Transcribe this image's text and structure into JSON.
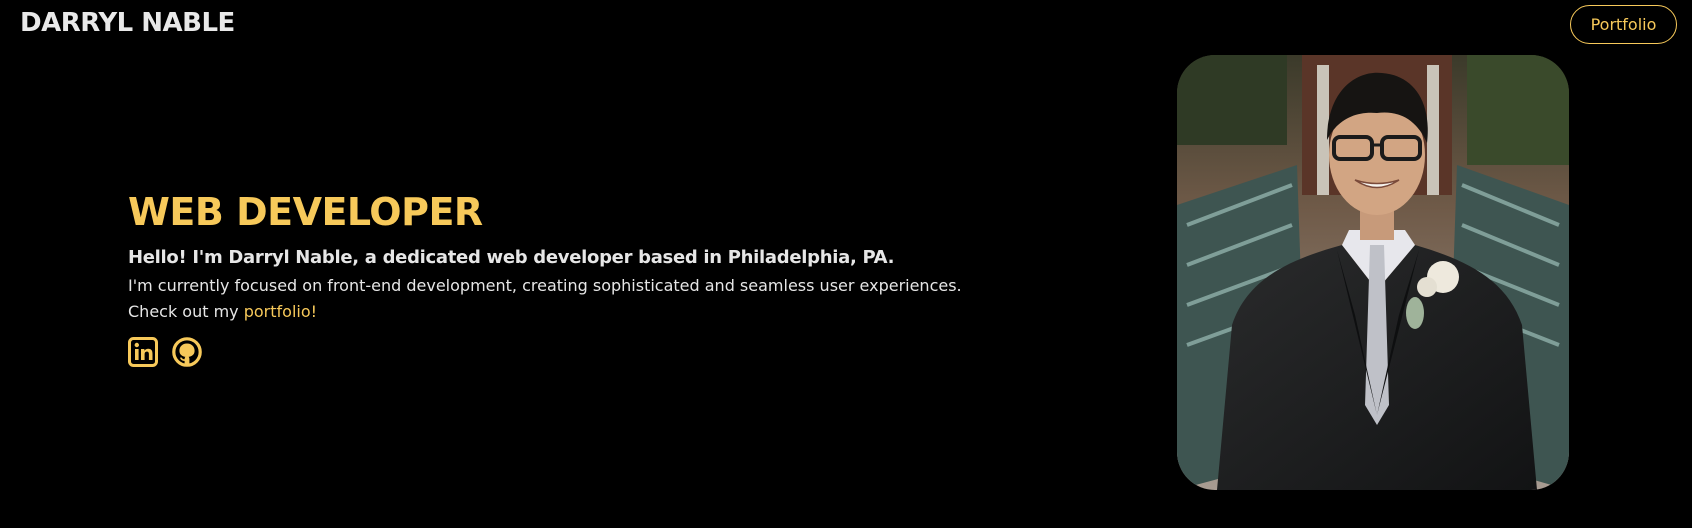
{
  "header": {
    "brand": "DARRYL NABLE",
    "nav_button": "Portfolio"
  },
  "hero": {
    "title": "WEB DEVELOPER",
    "subtitle": "Hello! I'm Darryl Nable, a dedicated web developer based in Philadelphia, PA.",
    "description": "I'm currently focused on front-end development, creating sophisticated and seamless user experiences.",
    "cta_prefix": "Check out my ",
    "cta_link": "portfolio!"
  },
  "socials": [
    {
      "icon": "linkedin-icon"
    },
    {
      "icon": "github-icon"
    }
  ],
  "colors": {
    "background": "#000000",
    "accent": "#f7c95a",
    "text": "#e6e6e6"
  }
}
